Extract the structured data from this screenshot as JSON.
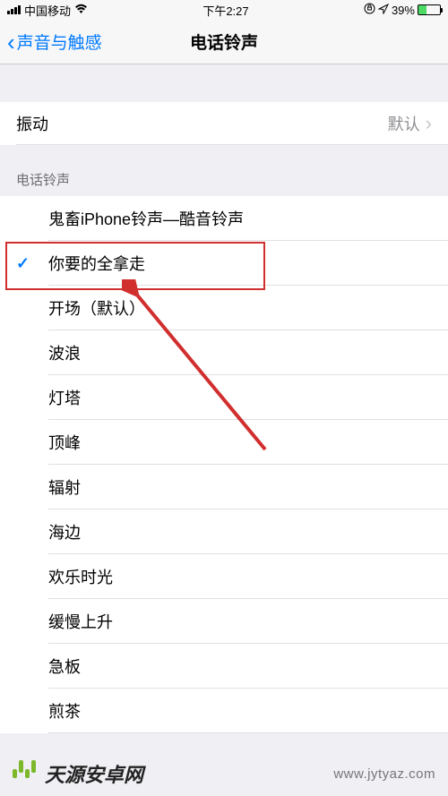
{
  "status_bar": {
    "carrier": "中国移动",
    "time": "下午2:27",
    "battery_pct": "39%"
  },
  "nav": {
    "back_label": "声音与触感",
    "title": "电话铃声"
  },
  "vibration": {
    "label": "振动",
    "value": "默认"
  },
  "section_header": "电话铃声",
  "ringtones": [
    {
      "label": "鬼畜iPhone铃声—酷音铃声",
      "selected": false
    },
    {
      "label": "你要的全拿走",
      "selected": true
    },
    {
      "label": "开场（默认）",
      "selected": false
    },
    {
      "label": "波浪",
      "selected": false
    },
    {
      "label": "灯塔",
      "selected": false
    },
    {
      "label": "顶峰",
      "selected": false
    },
    {
      "label": "辐射",
      "selected": false
    },
    {
      "label": "海边",
      "selected": false
    },
    {
      "label": "欢乐时光",
      "selected": false
    },
    {
      "label": "缓慢上升",
      "selected": false
    },
    {
      "label": "急板",
      "selected": false
    },
    {
      "label": "煎茶",
      "selected": false
    }
  ],
  "watermark": {
    "brand": "天源安卓网",
    "url": "www.jytyaz.com"
  }
}
